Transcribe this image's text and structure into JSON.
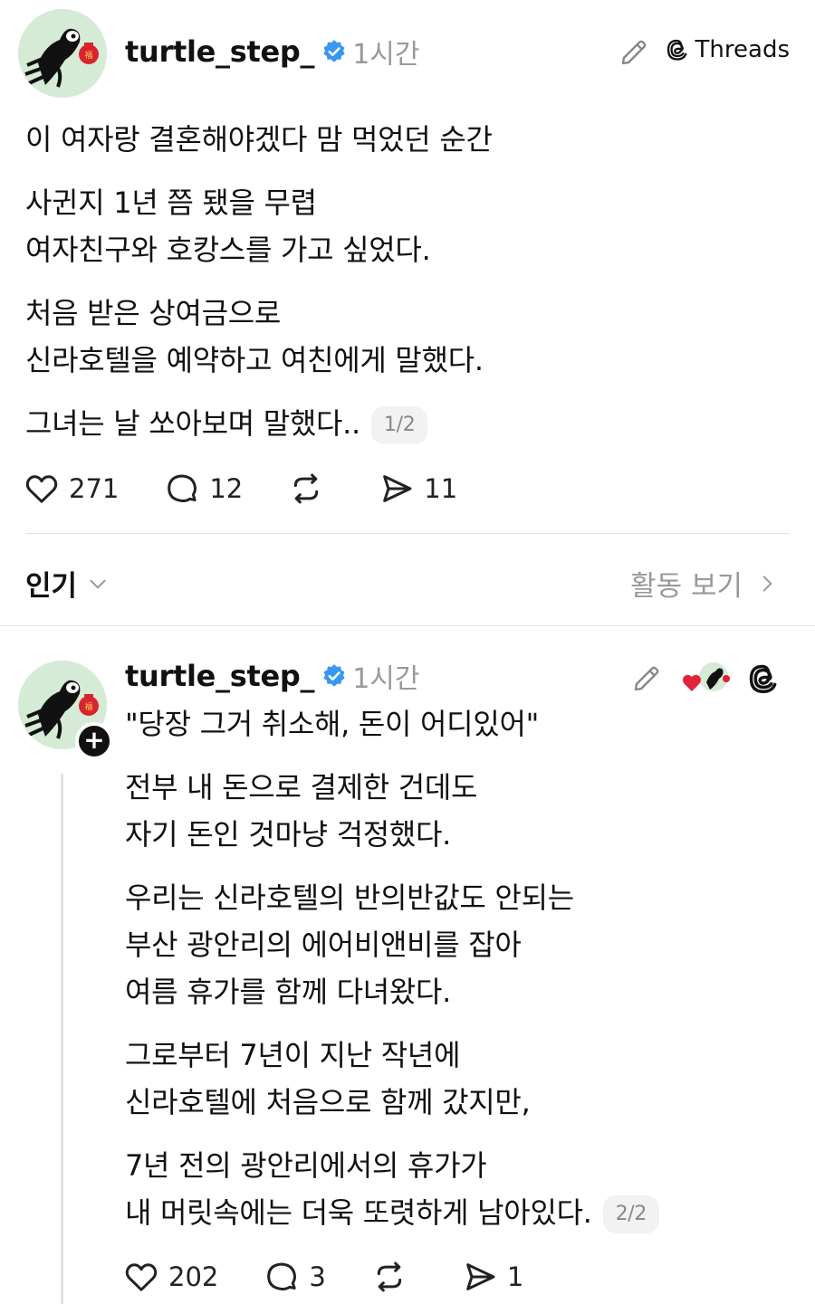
{
  "post1": {
    "username": "turtle_step_",
    "time": "1시간",
    "app_badge": "Threads",
    "paragraphs": [
      "이 여자랑 결혼해야겠다 맘 먹었던 순간",
      "사귄지 1년 쯤 됐을 무렵\n여자친구와 호캉스를 가고 싶었다.",
      "처음 받은 상여금으로\n신라호텔을 예약하고 여친에게 말했다.",
      "그녀는 날 쏘아보며 말했다.."
    ],
    "page": "1/2",
    "likes": "271",
    "comments": "12",
    "shares": "11"
  },
  "sort": {
    "label": "인기",
    "activity": "활동 보기"
  },
  "post2": {
    "username": "turtle_step_",
    "time": "1시간",
    "paragraphs": [
      "\"당장 그거 취소해, 돈이 어디있어\"",
      "전부 내 돈으로 결제한 건데도\n자기 돈인 것마냥 걱정했다.",
      "우리는 신라호텔의 반의반값도 안되는\n부산 광안리의 에어비앤비를 잡아\n여름 휴가를 함께 다녀왔다.",
      "그로부터 7년이 지난 작년에\n신라호텔에 처음으로 함께 갔지만,",
      "7년 전의 광안리에서의 휴가가\n내 머릿속에는 더욱 또렷하게 남아있다."
    ],
    "page": "2/2",
    "likes": "202",
    "comments": "3",
    "shares": "1"
  },
  "colors": {
    "verified": "#3897f0",
    "muted": "#999999",
    "avatar_bg": "#d6ebd6",
    "heart_red": "#e0243c"
  }
}
